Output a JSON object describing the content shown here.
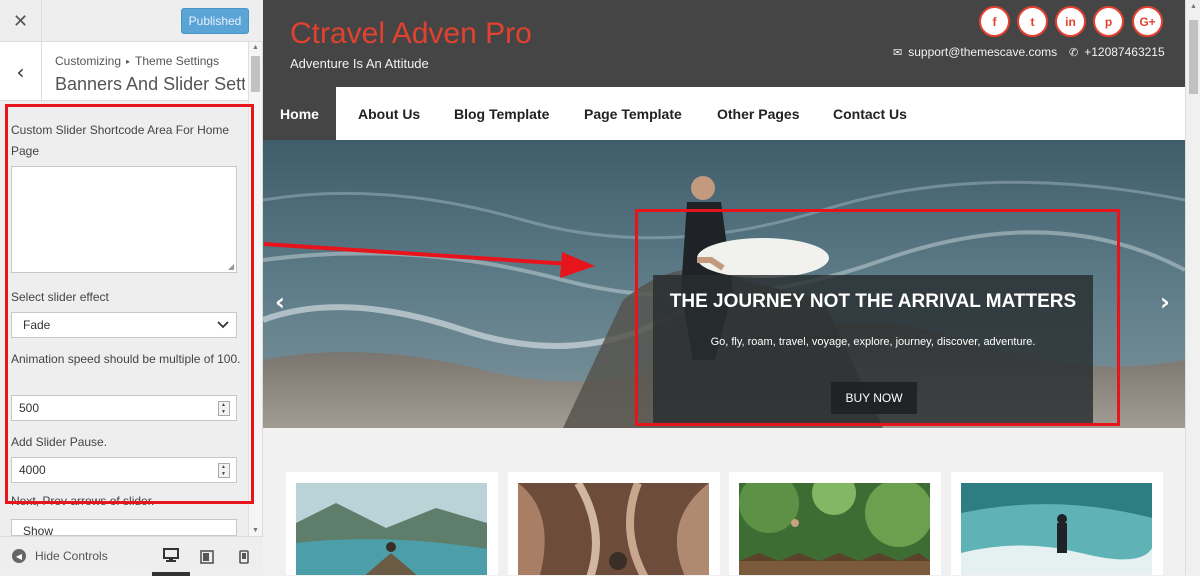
{
  "customizer": {
    "close_icon": "close-icon",
    "publish_label": "Published",
    "breadcrumb_root": "Customizing",
    "breadcrumb_child": "Theme Settings",
    "section_title": "Banners And Slider Settings",
    "controls": {
      "shortcode_label": "Custom Slider Shortcode Area For Home Page",
      "shortcode_value": "",
      "effect_label": "Select slider effect",
      "effect_value": "Fade",
      "speed_label": "Animation speed should be multiple of 100.",
      "speed_value": "500",
      "pause_label": "Add Slider Pause.",
      "pause_value": "4000",
      "arrows_label": "Next, Prev arrows of slider.",
      "arrows_value": "Show"
    },
    "footer": {
      "hide_controls": "Hide Controls"
    }
  },
  "site": {
    "title": "Ctravel Adven Pro",
    "tagline": "Adventure Is An Attitude",
    "email": "support@themescave.coms",
    "phone": "+12087463215",
    "social": [
      "f",
      "t",
      "in",
      "p",
      "G+"
    ],
    "nav": [
      "Home",
      "About Us",
      "Blog Template",
      "Page Template",
      "Other Pages",
      "Contact Us"
    ],
    "slider": {
      "title": "THE JOURNEY NOT THE ARRIVAL MATTERS",
      "subtitle": "Go, fly, roam, travel, voyage, explore, journey, discover, adventure.",
      "button": "BUY NOW"
    }
  },
  "colors": {
    "accent_red": "#e3412f",
    "annotation_red": "#e8141b",
    "header_bg": "#454545",
    "publish_blue": "#5ba4d6"
  }
}
